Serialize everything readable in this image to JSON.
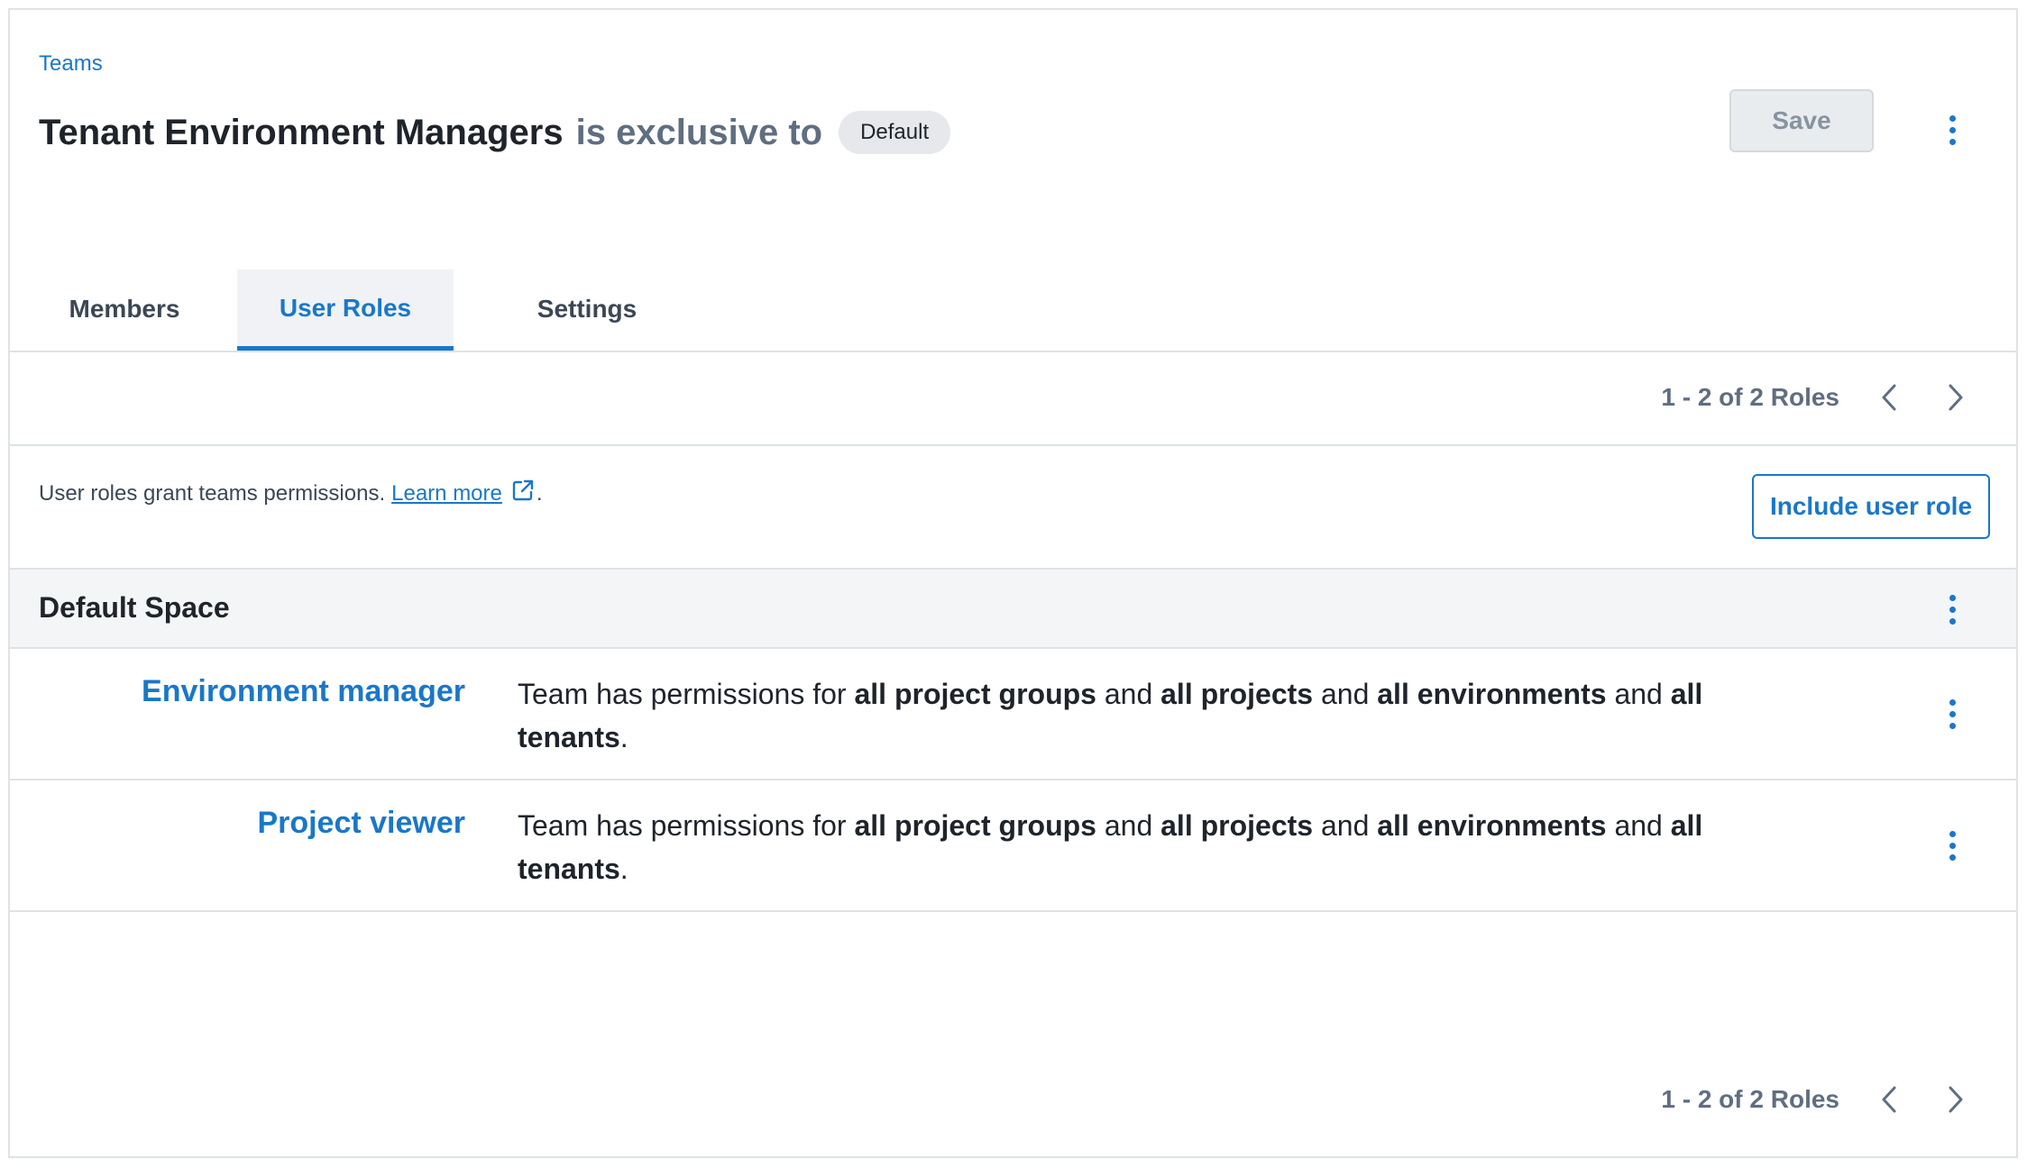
{
  "breadcrumb": "Teams",
  "header": {
    "team_name": "Tenant Environment Managers",
    "exclusive_text": "is exclusive to",
    "space_badge": "Default",
    "save_label": "Save"
  },
  "tabs": [
    {
      "label": "Members",
      "active": false
    },
    {
      "label": "User Roles",
      "active": true
    },
    {
      "label": "Settings",
      "active": false
    }
  ],
  "pagination": {
    "text": "1 - 2 of 2 Roles"
  },
  "intro": {
    "text": "User roles grant teams permissions.",
    "link_label": "Learn more",
    "trailing": "."
  },
  "include_button": "Include user role",
  "space": {
    "title": "Default Space"
  },
  "roles": [
    {
      "name": "Environment manager",
      "desc": {
        "prefix": "Team has permissions for",
        "p1": "all project groups",
        "and1": "and",
        "p2": "all projects",
        "and2": "and",
        "p3": "all environments",
        "and3": "and",
        "p4": "all tenants",
        "end": "."
      }
    },
    {
      "name": "Project viewer",
      "desc": {
        "prefix": "Team has permissions for",
        "p1": "all project groups",
        "and1": "and",
        "p2": "all projects",
        "and2": "and",
        "p3": "all environments",
        "and3": "and",
        "p4": "all tenants",
        "end": "."
      }
    }
  ],
  "colors": {
    "accent": "#1a77c9",
    "muted": "#5f6e80",
    "border": "#dfe2e6"
  },
  "icons": [
    "more-vertical-icon",
    "chevron-left-icon",
    "chevron-right-icon",
    "external-link-icon"
  ]
}
